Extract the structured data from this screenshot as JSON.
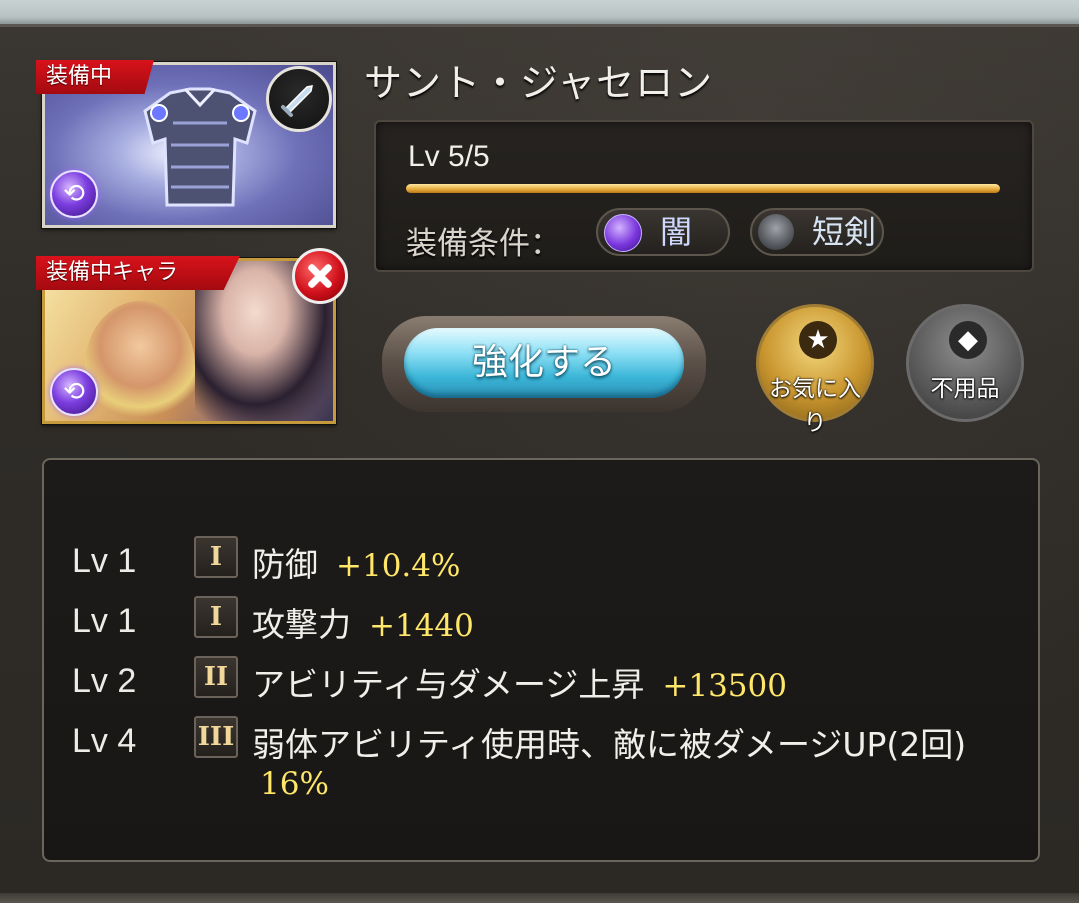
{
  "item": {
    "name": "サント・ジャセロン",
    "equipped_badge": "装備中",
    "level_text": "Lv 5/5",
    "level_progress": 1.0,
    "condition_label": "装備条件：",
    "condition_element": "闇",
    "condition_weapon": "短剣",
    "element_icon": "dark-element-icon",
    "weapon_type_icon": "dagger-icon"
  },
  "character": {
    "badge": "装備中キャラ",
    "element_icon": "dark-element-icon"
  },
  "actions": {
    "upgrade_label": "強化する",
    "favorite_label": "お気に入り",
    "unneeded_label": "不用品"
  },
  "skills": [
    {
      "lv": "Lv 1",
      "tier": "I",
      "name": "防御",
      "value": "+10.4%"
    },
    {
      "lv": "Lv 1",
      "tier": "I",
      "name": "攻撃力",
      "value": "+1440"
    },
    {
      "lv": "Lv 2",
      "tier": "II",
      "name": "アビリティ与ダメージ上昇",
      "value": "+13500"
    },
    {
      "lv": "Lv 4",
      "tier": "III",
      "name": "弱体アビリティ使用時、敵に被ダメージUP(2回)",
      "value": "16%"
    }
  ],
  "colors": {
    "accent_gold": "#e5a93a",
    "badge_red": "#d8121b",
    "value_yellow": "#ffe76a",
    "dark_element": "#7a36dd"
  }
}
